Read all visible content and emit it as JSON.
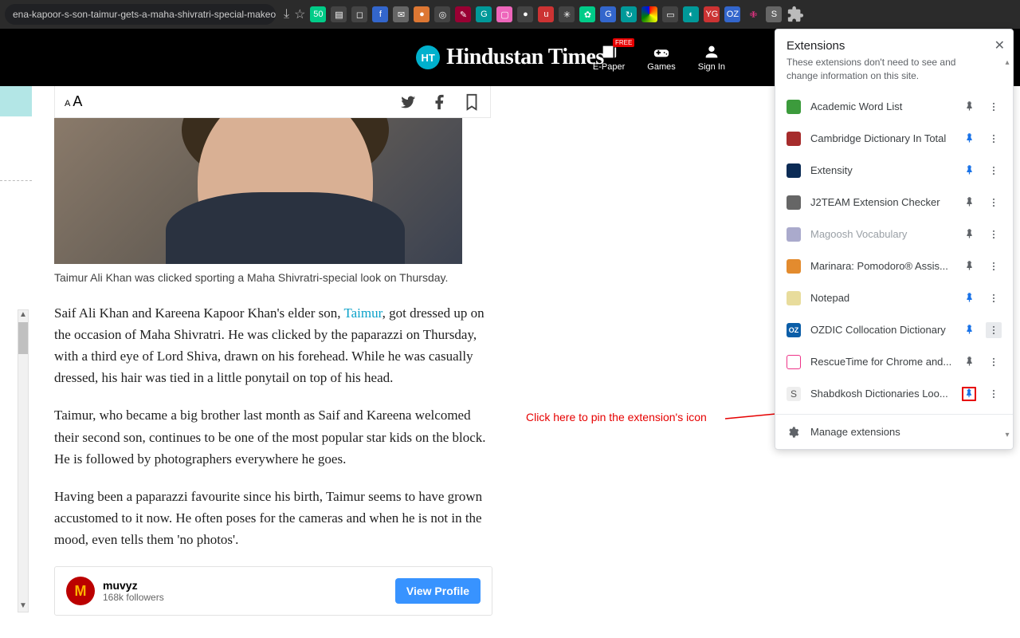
{
  "browser": {
    "address_text": "ena-kapoor-s-son-taimur-gets-a-maha-shivratri-special-makeover-s..."
  },
  "site_header": {
    "brand_text": "Hindustan Times",
    "items": {
      "epaper": {
        "label": "E-Paper",
        "badge": "FREE"
      },
      "games": {
        "label": "Games"
      },
      "signin": {
        "label": "Sign In"
      }
    }
  },
  "article": {
    "caption": "Taimur Ali Khan was clicked sporting a Maha Shivratri-special look on Thursday.",
    "p1_a": "Saif Ali Khan and Kareena Kapoor Khan's elder son, ",
    "p1_link": "Taimur",
    "p1_b": ", got dressed up on the occasion of Maha Shivratri. He was clicked by the paparazzi on Thursday, with a third eye of Lord Shiva, drawn on his forehead. While he was casually dressed, his hair was tied in a little ponytail on top of his head.",
    "p2": "Taimur, who became a big brother last month as Saif and Kareena welcomed their second son, continues to be one of the most popular star kids on the block. He is followed by photographers everywhere he goes.",
    "p3": "Having been a paparazzi favourite since his birth, Taimur seems to have grown accustomed to it now. He often poses for the cameras and when he is not in the mood, even tells them 'no photos'."
  },
  "embed": {
    "name": "muvyz",
    "followers": "168k followers",
    "button": "View Profile"
  },
  "ext_popup": {
    "title": "Extensions",
    "subtitle": "These extensions don't need to see and change information on this site.",
    "manage": "Manage extensions",
    "items": [
      {
        "name": "Academic Word List",
        "pinned": false,
        "disabled": false,
        "icon": "ic-green"
      },
      {
        "name": "Cambridge Dictionary In Total",
        "pinned": true,
        "disabled": false,
        "icon": "ic-red"
      },
      {
        "name": "Extensity",
        "pinned": true,
        "disabled": false,
        "icon": "ic-darkblue"
      },
      {
        "name": "J2TEAM Extension Checker",
        "pinned": false,
        "disabled": false,
        "icon": "ic-gray"
      },
      {
        "name": "Magoosh Vocabulary",
        "pinned": false,
        "disabled": true,
        "icon": "ic-light"
      },
      {
        "name": "Marinara: Pomodoro® Assis...",
        "pinned": false,
        "disabled": false,
        "icon": "ic-orange"
      },
      {
        "name": "Notepad",
        "pinned": true,
        "disabled": false,
        "icon": "ic-note"
      },
      {
        "name": "OZDIC Collocation Dictionary",
        "pinned": true,
        "disabled": false,
        "icon": "ic-oz",
        "more_hover": true
      },
      {
        "name": "RescueTime for Chrome and...",
        "pinned": false,
        "disabled": false,
        "icon": "ic-rt"
      },
      {
        "name": "Shabdkosh Dictionaries Loo...",
        "pinned": true,
        "disabled": false,
        "icon": "ic-s",
        "highlight": true
      }
    ]
  },
  "annotation": {
    "text": "Click here to pin the extension's icon"
  }
}
